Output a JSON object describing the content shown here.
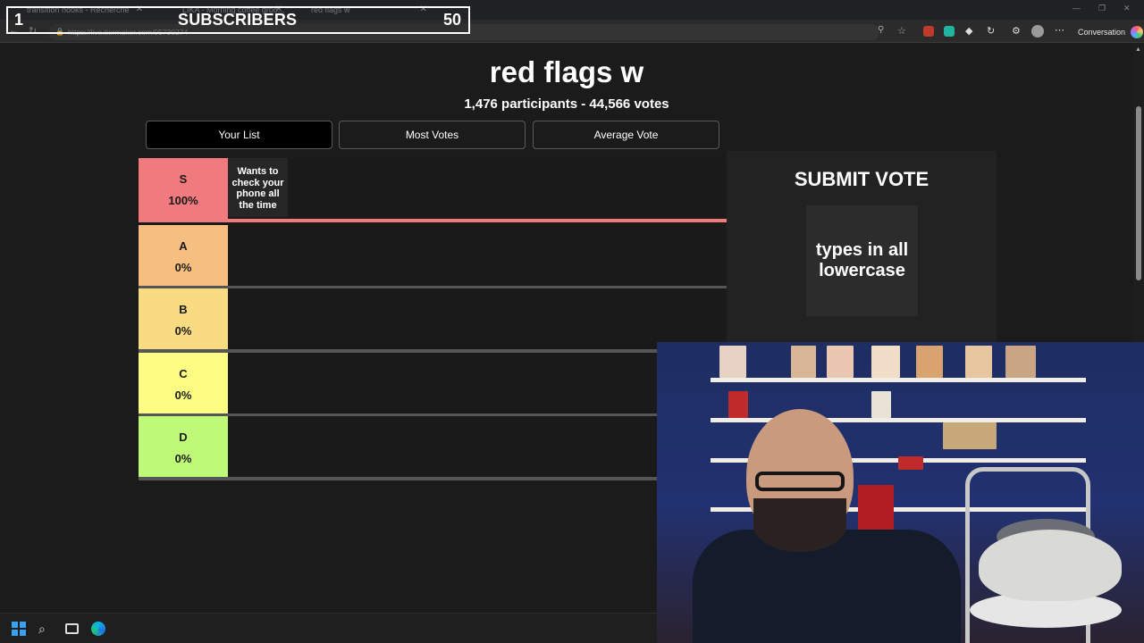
{
  "browser": {
    "tabs": [
      {
        "label": "transition hooks - Recherche"
      },
      {
        "label": "LIKA - Morning coffee groo..."
      },
      {
        "label": "red flags w"
      }
    ],
    "url": "https://live.tiermaker.com/95730274",
    "conversation_label": "Conversation"
  },
  "overlay": {
    "left_count": "1",
    "label": "SUBSCRIBERS",
    "right_count": "50"
  },
  "page": {
    "title": "red flags w",
    "stats": "1,476 participants - 44,566 votes",
    "tabs": [
      {
        "label": "Your List",
        "active": true
      },
      {
        "label": "Most Votes",
        "active": false
      },
      {
        "label": "Average Vote",
        "active": false
      }
    ],
    "tiers": [
      {
        "letter": "S",
        "percent": "100%",
        "fraction": 1.0,
        "color": "#f07a7d",
        "bar_color": "#f07a7d",
        "item": "Wants to check your phone all the time"
      },
      {
        "letter": "A",
        "percent": "0%",
        "fraction": 0.0,
        "color": "#f6bf80",
        "bar_color": "#555555",
        "item": ""
      },
      {
        "letter": "B",
        "percent": "0%",
        "fraction": 0.0,
        "color": "#f9dc81",
        "bar_color": "#555555",
        "item": ""
      },
      {
        "letter": "C",
        "percent": "0%",
        "fraction": 0.0,
        "color": "#fdfd83",
        "bar_color": "#555555",
        "item": ""
      },
      {
        "letter": "D",
        "percent": "0%",
        "fraction": 0.0,
        "color": "#bff978",
        "bar_color": "#555555",
        "item": ""
      }
    ],
    "submit": {
      "heading": "SUBMIT VOTE",
      "item": "types in all lowercase"
    }
  },
  "colors": {
    "page_bg": "#1b1b1b",
    "accent": "#f07a7d"
  }
}
